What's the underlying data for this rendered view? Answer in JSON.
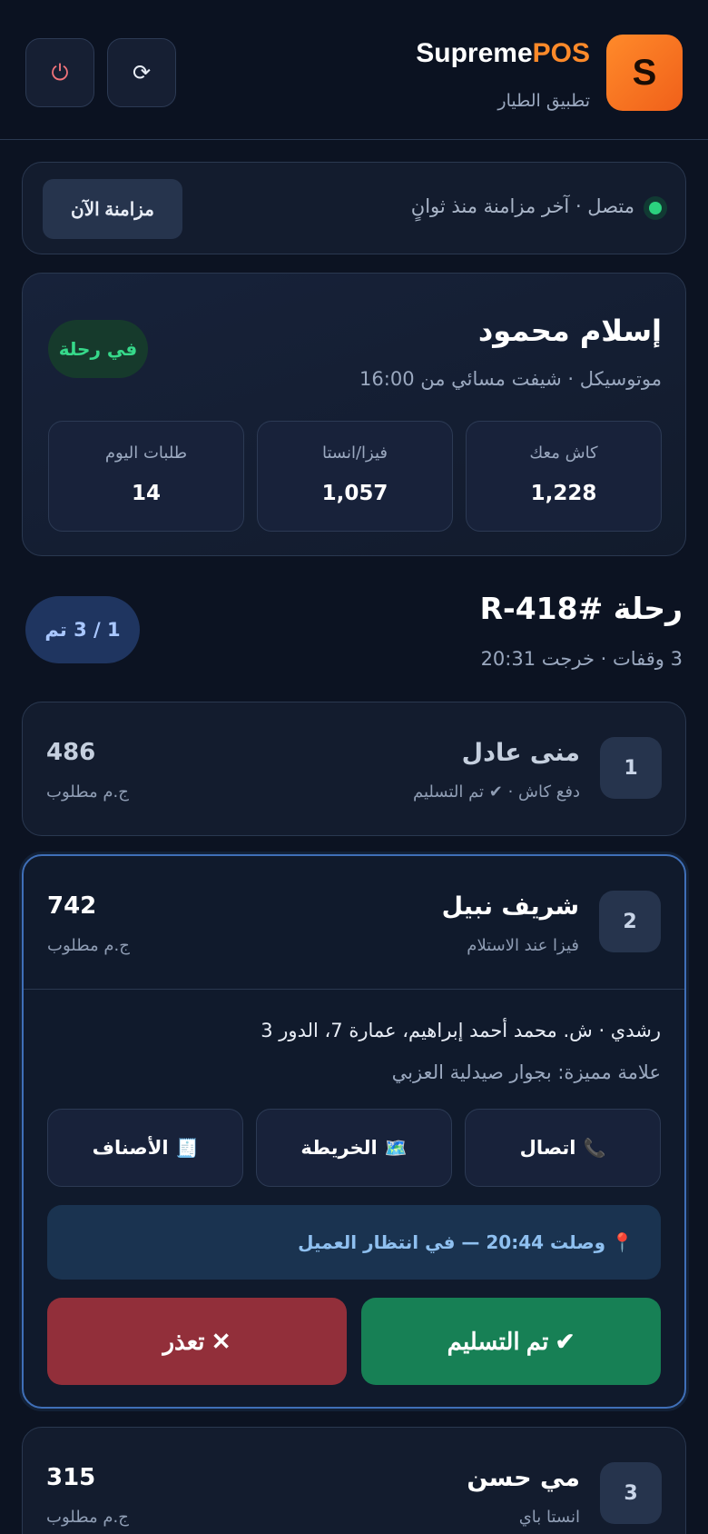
{
  "header": {
    "logo_letter": "S",
    "brand_part1": "Supreme",
    "brand_part2": "POS",
    "subtitle": "تطبيق الطيار",
    "refresh_icon": "⟳",
    "power_icon": "⏻"
  },
  "sync": {
    "status": "متصل · آخر مزامنة منذ ثوانٍ",
    "button": "مزامنة الآن"
  },
  "driver": {
    "name": "إسلام محمود",
    "meta": "موتوسيكل · شيفت مسائي من 16:00",
    "status": "في رحلة",
    "stats": [
      {
        "label": "كاش معك",
        "value": "1,228"
      },
      {
        "label": "فيزا/انستا",
        "value": "1,057"
      },
      {
        "label": "طلبات اليوم",
        "value": "14"
      }
    ]
  },
  "trip": {
    "title": "رحلة #R-418",
    "meta": "3 وقفات · خرجت 20:31",
    "progress": "1 / 3 تم"
  },
  "stops": [
    {
      "num": "1",
      "name": "منى عادل",
      "sub": "دفع كاش · ✔ تم التسليم",
      "amount": "486",
      "amount_label": "ج.م مطلوب"
    },
    {
      "num": "2",
      "name": "شريف نبيل",
      "sub": "فيزا عند الاستلام",
      "amount": "742",
      "amount_label": "ج.م مطلوب",
      "address": "رشدي · ش. محمد أحمد إبراهيم، عمارة 7، الدور 3",
      "landmark": "علامة مميزة: بجوار صيدلية العزبي",
      "actions": {
        "call": "اتصال",
        "call_icon": "📞",
        "map": "الخريطة",
        "map_icon": "🗺️",
        "items": "الأصناف",
        "items_icon": "🧾"
      },
      "arrived_icon": "📍",
      "arrived": "وصلت 20:44 — في انتظار العميل",
      "delivered_button": "✔ تم التسليم",
      "fail_button": "✕ تعذر"
    },
    {
      "num": "3",
      "name": "مي حسن",
      "sub": "انستا باي",
      "amount": "315",
      "amount_label": "ج.م مطلوب"
    }
  ]
}
